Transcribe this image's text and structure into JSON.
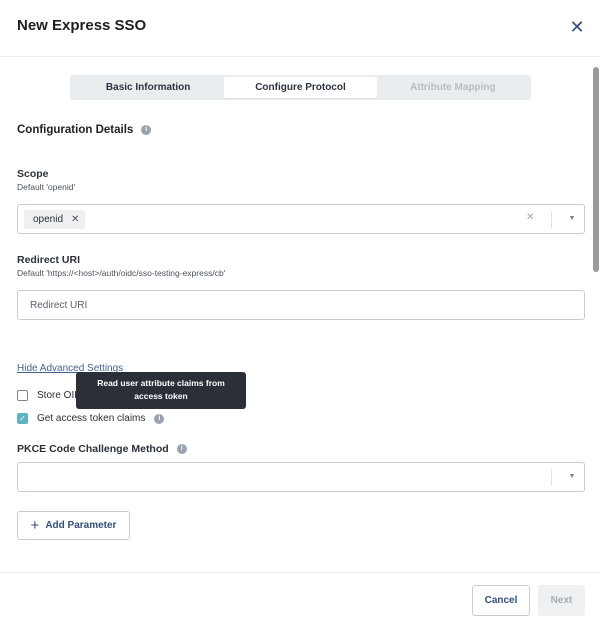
{
  "dialog": {
    "title": "New Express SSO",
    "close_glyph": "✕"
  },
  "tabs": [
    {
      "label": "Basic Information",
      "state": "normal"
    },
    {
      "label": "Configure Protocol",
      "state": "active"
    },
    {
      "label": "Attribute Mapping",
      "state": "disabled"
    }
  ],
  "section": {
    "title": "Configuration Details",
    "info_icon": "info-icon"
  },
  "scope": {
    "label": "Scope",
    "hint": "Default 'openid'",
    "chips": [
      "openid"
    ],
    "chip_remove_glyph": "✕",
    "clear_glyph": "✕"
  },
  "redirect": {
    "label": "Redirect URI",
    "hint": "Default 'https://<host>/auth/oidc/sso-testing-express/cb'",
    "placeholder": "Redirect URI",
    "value": ""
  },
  "advanced": {
    "toggle_label": "Hide Advanced Settings",
    "store_label": "Store OIDC tokens",
    "store_checked": false,
    "claims_label": "Get access token claims",
    "claims_checked": true
  },
  "tooltip": {
    "line1": "Read user attribute claims from",
    "line2": "access token"
  },
  "pkce": {
    "label": "PKCE Code Challenge Method",
    "value": ""
  },
  "add_parameter": {
    "label": "Add Parameter",
    "glyph": "+"
  },
  "footer": {
    "cancel_label": "Cancel",
    "next_label": "Next"
  },
  "colors": {
    "accent": "#33507a",
    "check": "#5cb3c2",
    "tooltip_bg": "#2b3038"
  }
}
